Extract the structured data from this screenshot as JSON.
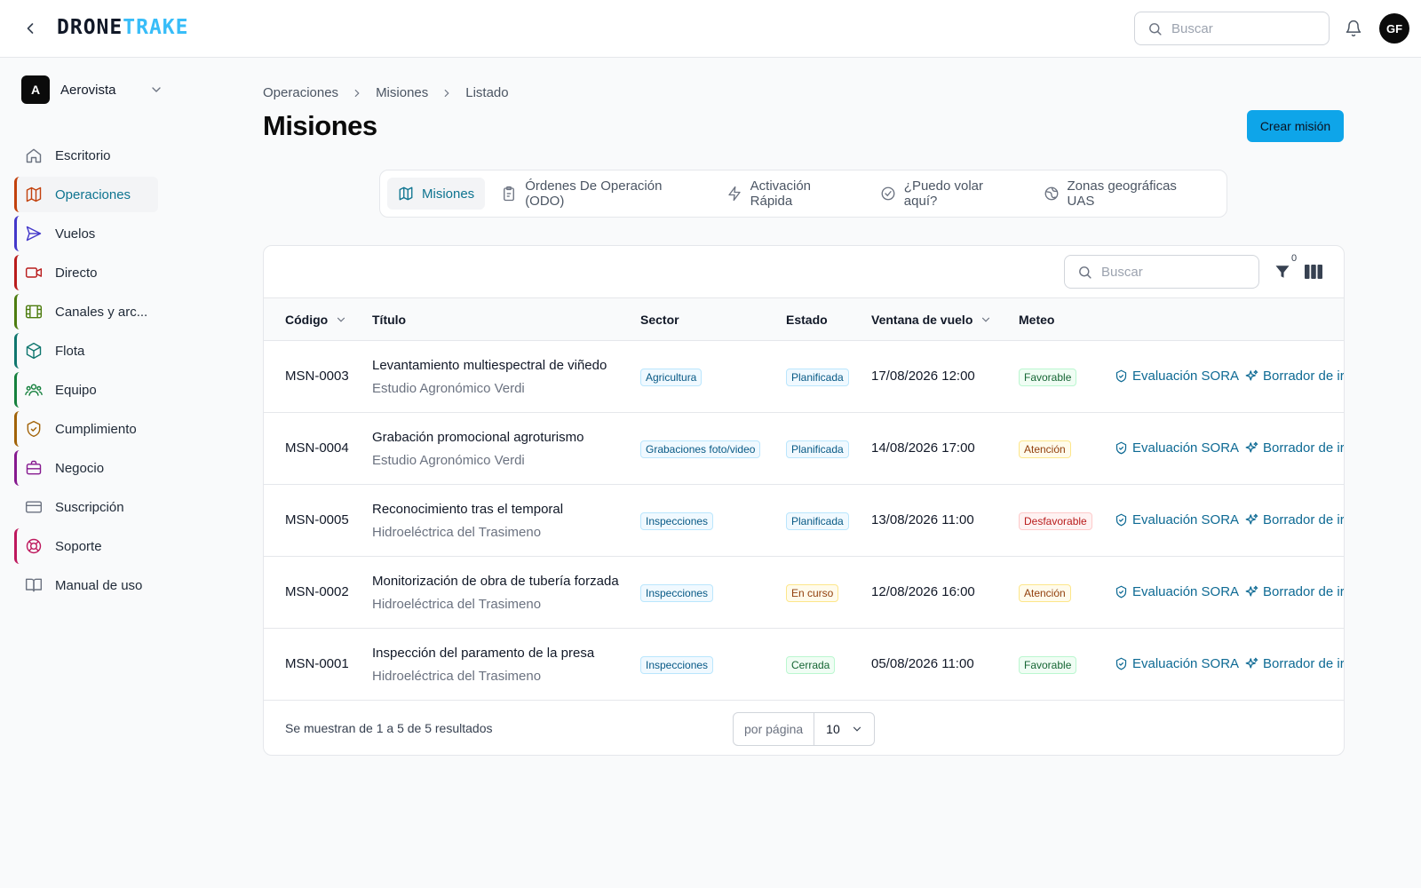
{
  "header": {
    "logo_part1": "DRONE",
    "logo_part2": "TRAKE",
    "search_placeholder": "Buscar",
    "avatar_initials": "GF",
    "colors": {
      "brand_dark": "#111827",
      "brand_accent": "#38bdf8"
    }
  },
  "sidebar": {
    "org": {
      "initial": "A",
      "name": "Aerovista"
    },
    "items": [
      {
        "label": "Escritorio",
        "icon": "home-icon",
        "accent": ""
      },
      {
        "label": "Operaciones",
        "icon": "map-icon",
        "accent": "#c2410c",
        "active": true
      },
      {
        "label": "Vuelos",
        "icon": "send-icon",
        "accent": "#4338ca"
      },
      {
        "label": "Directo",
        "icon": "video-icon",
        "accent": "#b91c1c"
      },
      {
        "label": "Canales y arc...",
        "icon": "film-icon",
        "accent": "#4d7c0f"
      },
      {
        "label": "Flota",
        "icon": "cube-icon",
        "accent": "#0f766e"
      },
      {
        "label": "Equipo",
        "icon": "users-icon",
        "accent": "#15803d"
      },
      {
        "label": "Cumplimiento",
        "icon": "shield-check-icon",
        "accent": "#a16207"
      },
      {
        "label": "Negocio",
        "icon": "briefcase-icon",
        "accent": "#86198f"
      },
      {
        "label": "Suscripción",
        "icon": "credit-card-icon",
        "accent": ""
      },
      {
        "label": "Soporte",
        "icon": "lifebuoy-icon",
        "accent": "#be185d"
      },
      {
        "label": "Manual de uso",
        "icon": "book-icon",
        "accent": ""
      }
    ]
  },
  "breadcrumb": [
    "Operaciones",
    "Misiones",
    "Listado"
  ],
  "page": {
    "title": "Misiones",
    "create_button": "Crear misión",
    "accent_color": "#0ea5e9"
  },
  "tabs": [
    {
      "label": "Misiones",
      "icon": "map-icon",
      "active": true
    },
    {
      "label": "Órdenes De Operación (ODO)",
      "icon": "clipboard-icon"
    },
    {
      "label": "Activación Rápida",
      "icon": "zap-icon"
    },
    {
      "label": "¿Puedo volar aquí?",
      "icon": "check-circle-icon"
    },
    {
      "label": "Zonas geográficas UAS",
      "icon": "globe-icon"
    }
  ],
  "table": {
    "search_placeholder": "Buscar",
    "filter_count": "0",
    "headers": {
      "code": "Código",
      "title": "Título",
      "sector": "Sector",
      "status": "Estado",
      "window": "Ventana de vuelo",
      "meteo": "Meteo"
    },
    "rows": [
      {
        "code": "MSN-0003",
        "title": "Levantamiento multiespectral de viñedo",
        "client": "Estudio Agronómico Verdi",
        "sector": "Agricultura",
        "status": "Planificada",
        "status_tone": "blue",
        "window": "17/08/2026 12:00",
        "meteo": "Favorable",
        "meteo_tone": "green",
        "action1": "Evaluación SORA",
        "action2": "Borrador de ir"
      },
      {
        "code": "MSN-0004",
        "title": "Grabación promocional agroturismo",
        "client": "Estudio Agronómico Verdi",
        "sector": "Grabaciones foto/video",
        "status": "Planificada",
        "status_tone": "blue",
        "window": "14/08/2026 17:00",
        "meteo": "Atención",
        "meteo_tone": "amber",
        "action1": "Evaluación SORA",
        "action2": "Borrador de ir"
      },
      {
        "code": "MSN-0005",
        "title": "Reconocimiento tras el temporal",
        "client": "Hidroeléctrica del Trasimeno",
        "sector": "Inspecciones",
        "status": "Planificada",
        "status_tone": "blue",
        "window": "13/08/2026 11:00",
        "meteo": "Desfavorable",
        "meteo_tone": "red",
        "action1": "Evaluación SORA",
        "action2": "Borrador de ir"
      },
      {
        "code": "MSN-0002",
        "title": "Monitorización de obra de tubería forzada",
        "client": "Hidroeléctrica del Trasimeno",
        "sector": "Inspecciones",
        "status": "En curso",
        "status_tone": "amber",
        "window": "12/08/2026 16:00",
        "meteo": "Atención",
        "meteo_tone": "amber",
        "action1": "Evaluación SORA",
        "action2": "Borrador de ir"
      },
      {
        "code": "MSN-0001",
        "title": "Inspección del paramento de la presa",
        "client": "Hidroeléctrica del Trasimeno",
        "sector": "Inspecciones",
        "status": "Cerrada",
        "status_tone": "green",
        "window": "05/08/2026 11:00",
        "meteo": "Favorable",
        "meteo_tone": "green",
        "action1": "Evaluación SORA",
        "action2": "Borrador de ir"
      }
    ],
    "footer": {
      "summary": "Se muestran de 1 a 5 de 5 resultados",
      "per_page_label": "por página",
      "per_page_value": "10"
    }
  }
}
